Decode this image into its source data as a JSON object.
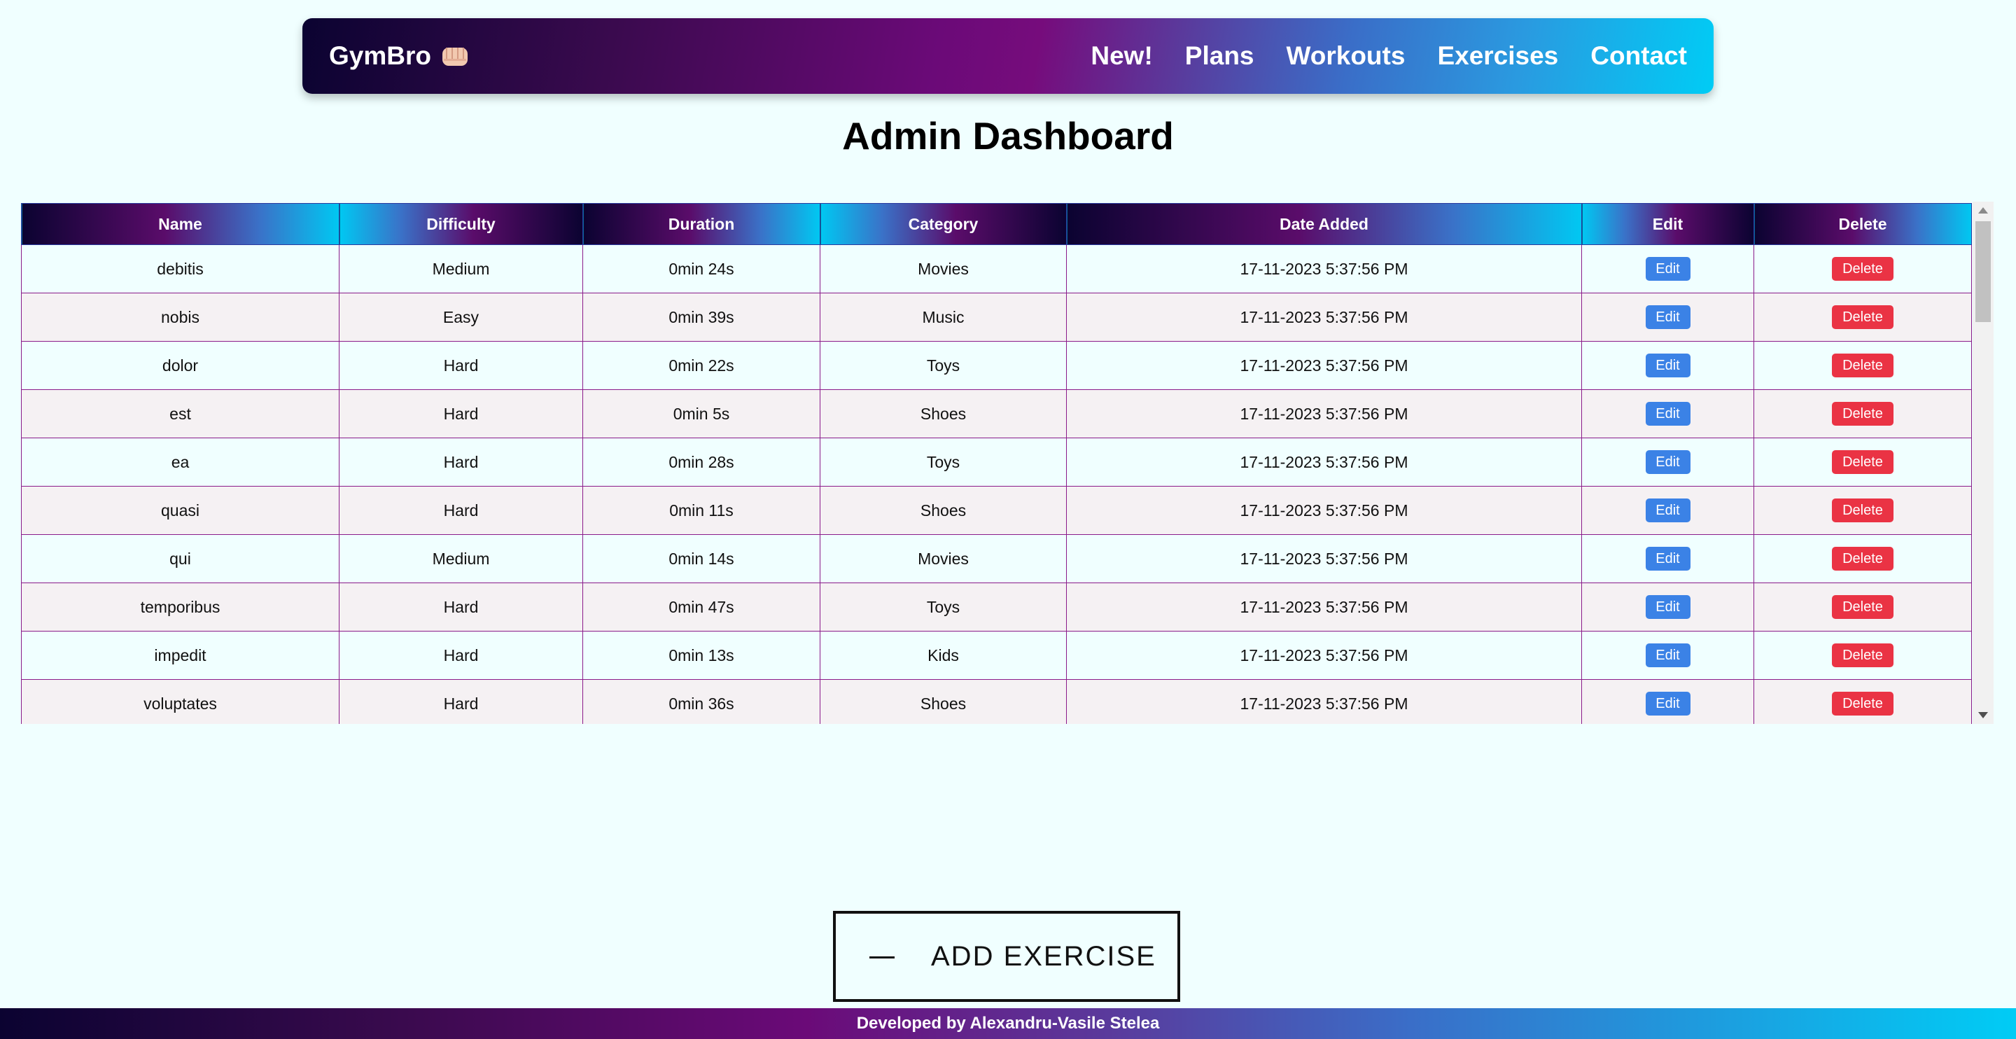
{
  "header": {
    "brand": "GymBro",
    "brand_icon": "fist-icon",
    "nav": [
      {
        "label": "New!"
      },
      {
        "label": "Plans"
      },
      {
        "label": "Workouts"
      },
      {
        "label": "Exercises"
      },
      {
        "label": "Contact"
      }
    ]
  },
  "page_title": "Admin Dashboard",
  "table": {
    "columns": [
      "Name",
      "Difficulty",
      "Duration",
      "Category",
      "Date Added",
      "Edit",
      "Delete"
    ],
    "edit_label": "Edit",
    "delete_label": "Delete",
    "rows": [
      {
        "name": "debitis",
        "difficulty": "Medium",
        "duration": "0min 24s",
        "category": "Movies",
        "date": "17-11-2023 5:37:56 PM"
      },
      {
        "name": "nobis",
        "difficulty": "Easy",
        "duration": "0min 39s",
        "category": "Music",
        "date": "17-11-2023 5:37:56 PM"
      },
      {
        "name": "dolor",
        "difficulty": "Hard",
        "duration": "0min 22s",
        "category": "Toys",
        "date": "17-11-2023 5:37:56 PM"
      },
      {
        "name": "est",
        "difficulty": "Hard",
        "duration": "0min 5s",
        "category": "Shoes",
        "date": "17-11-2023 5:37:56 PM"
      },
      {
        "name": "ea",
        "difficulty": "Hard",
        "duration": "0min 28s",
        "category": "Toys",
        "date": "17-11-2023 5:37:56 PM"
      },
      {
        "name": "quasi",
        "difficulty": "Hard",
        "duration": "0min 11s",
        "category": "Shoes",
        "date": "17-11-2023 5:37:56 PM"
      },
      {
        "name": "qui",
        "difficulty": "Medium",
        "duration": "0min 14s",
        "category": "Movies",
        "date": "17-11-2023 5:37:56 PM"
      },
      {
        "name": "temporibus",
        "difficulty": "Hard",
        "duration": "0min 47s",
        "category": "Toys",
        "date": "17-11-2023 5:37:56 PM"
      },
      {
        "name": "impedit",
        "difficulty": "Hard",
        "duration": "0min 13s",
        "category": "Kids",
        "date": "17-11-2023 5:37:56 PM"
      },
      {
        "name": "voluptates",
        "difficulty": "Hard",
        "duration": "0min 36s",
        "category": "Shoes",
        "date": "17-11-2023 5:37:56 PM"
      }
    ]
  },
  "add_button": {
    "label": "ADD EXERCISE"
  },
  "footer": {
    "text": "Developed by Alexandru-Vasile Stelea"
  },
  "colors": {
    "edit": "#3b82e6",
    "delete": "#ea3344",
    "background": "#f0ffff"
  }
}
